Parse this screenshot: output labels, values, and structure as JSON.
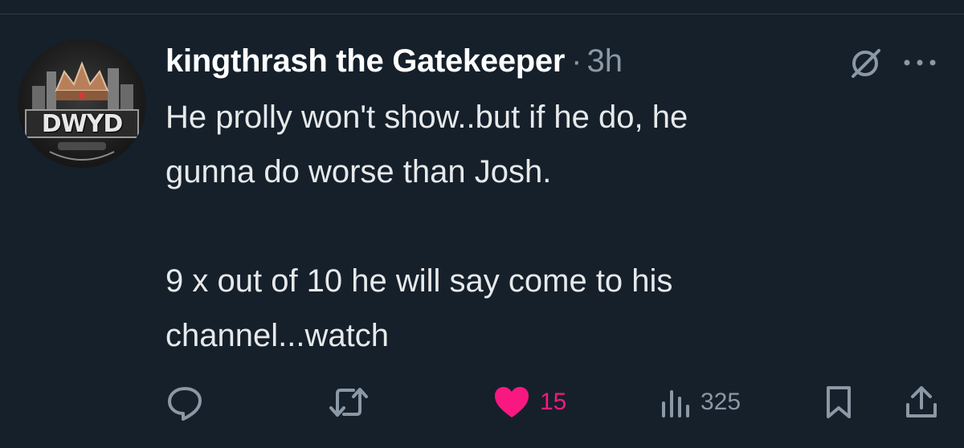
{
  "tweet": {
    "display_name": "kingthrash the Gatekeeper",
    "separator": "·",
    "timestamp": "3h",
    "avatar_text": "DWYD",
    "paragraphs": [
      "He prolly won't show..but if he do, he\ngunna do worse than Josh.",
      "9 x out of 10 he will say come to his\nchannel...watch"
    ]
  },
  "actions": {
    "reply_icon": "reply-icon",
    "retweet_icon": "retweet-icon",
    "like_icon": "heart-icon",
    "like_count": "15",
    "views_icon": "views-icon",
    "view_count": "325",
    "bookmark_icon": "bookmark-icon",
    "share_icon": "share-icon"
  },
  "colors": {
    "background": "#15202b",
    "text": "#e7e9ea",
    "muted": "#8b98a5",
    "like_active": "#f91880"
  }
}
